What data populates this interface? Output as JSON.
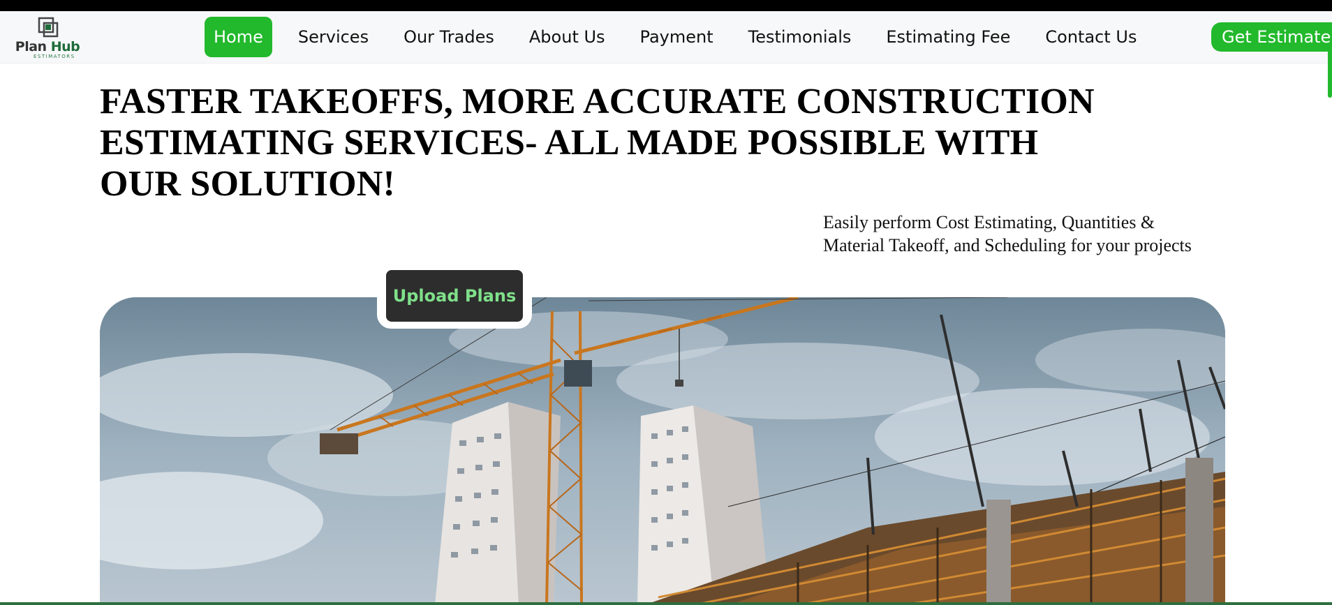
{
  "brand": {
    "name_part1": "Plan",
    "name_part2": "Hub",
    "tagline": "ESTIMATORS",
    "icon": "logo-mark-icon"
  },
  "nav": {
    "items": [
      {
        "label": "Home",
        "active": true
      },
      {
        "label": "Services",
        "active": false
      },
      {
        "label": "Our Trades",
        "active": false
      },
      {
        "label": "About Us",
        "active": false
      },
      {
        "label": "Payment",
        "active": false
      },
      {
        "label": "Testimonials",
        "active": false
      },
      {
        "label": "Estimating Fee",
        "active": false
      },
      {
        "label": "Contact Us",
        "active": false
      }
    ],
    "cta_label": "Get Estimate"
  },
  "hero": {
    "headline": "FASTER TAKEOFFS, MORE ACCURATE CONSTRUCTION ESTIMATING SERVICES- ALL MADE POSSIBLE WITH OUR SOLUTION!",
    "subtext": "Easily perform Cost Estimating, Quantities & Material Takeoff, and Scheduling for your projects",
    "upload_label": "Upload Plans",
    "image": "construction-site-crane-image"
  },
  "colors": {
    "accent": "#22b92c",
    "upload_bg": "#2d2d2d",
    "upload_text": "#7fe08a",
    "brand_dark": "#1e6b3a"
  }
}
